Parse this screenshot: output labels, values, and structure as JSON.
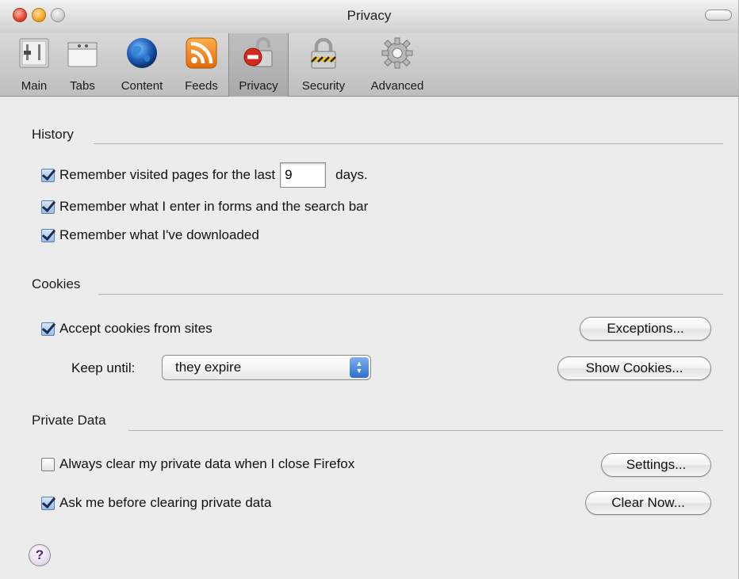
{
  "window": {
    "title": "Privacy"
  },
  "toolbar": {
    "items": [
      {
        "label": "Main",
        "icon": "main-switch-icon"
      },
      {
        "label": "Tabs",
        "icon": "tabs-window-icon"
      },
      {
        "label": "Content",
        "icon": "globe-icon"
      },
      {
        "label": "Feeds",
        "icon": "rss-feed-icon"
      },
      {
        "label": "Privacy",
        "icon": "privacy-lock-icon",
        "selected": true
      },
      {
        "label": "Security",
        "icon": "security-padlock-icon"
      },
      {
        "label": "Advanced",
        "icon": "gear-icon"
      }
    ]
  },
  "history": {
    "title": "History",
    "remember_visited_prefix": "Remember visited pages for the last",
    "days_value": "9",
    "days_suffix": "days.",
    "remember_forms": "Remember what I enter in forms and the search bar",
    "remember_downloads": "Remember what I've downloaded",
    "visited_checked": true,
    "forms_checked": true,
    "downloads_checked": true
  },
  "cookies": {
    "title": "Cookies",
    "accept_label": "Accept cookies from sites",
    "accept_checked": true,
    "keep_until_label": "Keep until:",
    "keep_until_value": "they expire",
    "exceptions_button": "Exceptions...",
    "show_cookies_button": "Show Cookies..."
  },
  "private_data": {
    "title": "Private Data",
    "always_clear_label": "Always clear my private data when I close Firefox",
    "always_clear_checked": false,
    "ask_before_label": "Ask me before clearing private data",
    "ask_before_checked": true,
    "settings_button": "Settings...",
    "clear_now_button": "Clear Now..."
  },
  "help": {
    "symbol": "?"
  },
  "colors": {
    "window_bg": "#ececec",
    "toolbar_bg": "#cbcbcb",
    "popup_arrow_blue": "#2d6fd0",
    "help_purple": "#4b2a7a"
  }
}
